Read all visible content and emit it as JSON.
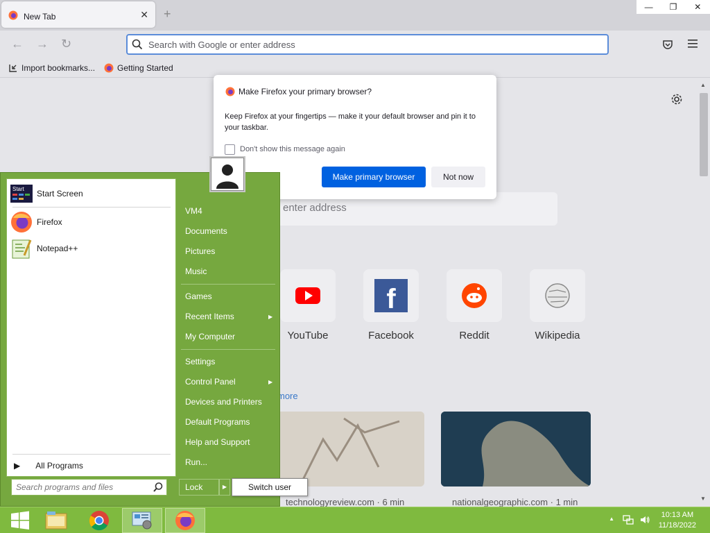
{
  "browser": {
    "tab_title": "New Tab",
    "tab_close": "✕",
    "new_tab": "+",
    "window_controls": {
      "minimize": "—",
      "restore": "❐",
      "close": "✕"
    },
    "urlbar_placeholder": "Search with Google or enter address",
    "bookmarks": [
      "Import bookmarks...",
      "Getting Started"
    ]
  },
  "newtab": {
    "search_hint": "enter address",
    "top_sites": [
      {
        "label": "YouTube",
        "color": "#ff0000"
      },
      {
        "label": "Facebook",
        "color": "#3b5998"
      },
      {
        "label": "Reddit",
        "color": "#ff4500"
      },
      {
        "label": "Wikipedia",
        "color": "#888888"
      }
    ],
    "more_link": "more",
    "stories": [
      {
        "source": "technologyreview.com · 6 min"
      },
      {
        "source": "nationalgeographic.com · 1 min"
      }
    ]
  },
  "dialog": {
    "title": "Make Firefox your primary browser?",
    "body": "Keep Firefox at your fingertips — make it your default browser and pin it to your taskbar.",
    "checkbox_label": "Don't show this message again",
    "primary_button": "Make primary browser",
    "secondary_button": "Not now"
  },
  "start_menu": {
    "pinned": [
      {
        "label": "Start Screen",
        "icon": "start-screen-icon"
      },
      {
        "label": "Firefox",
        "icon": "firefox-icon"
      },
      {
        "label": "Notepad++",
        "icon": "notepadpp-icon"
      }
    ],
    "all_programs": "All Programs",
    "search_placeholder": "Search programs and files",
    "right_items": {
      "group1": [
        "VM4",
        "Documents",
        "Pictures",
        "Music"
      ],
      "group2": [
        "Games",
        "Recent Items",
        "My Computer"
      ],
      "group3": [
        "Settings",
        "Control Panel",
        "Devices and Printers",
        "Default Programs",
        "Help and Support",
        "Run..."
      ]
    },
    "lock_label": "Lock",
    "switch_user": "Switch user"
  },
  "taskbar": {
    "time": "10:13 AM",
    "date": "11/18/2022"
  },
  "colors": {
    "start_menu_green": "#76a83f",
    "taskbar_green": "#7fba3f",
    "firefox_blue": "#0061e0"
  }
}
